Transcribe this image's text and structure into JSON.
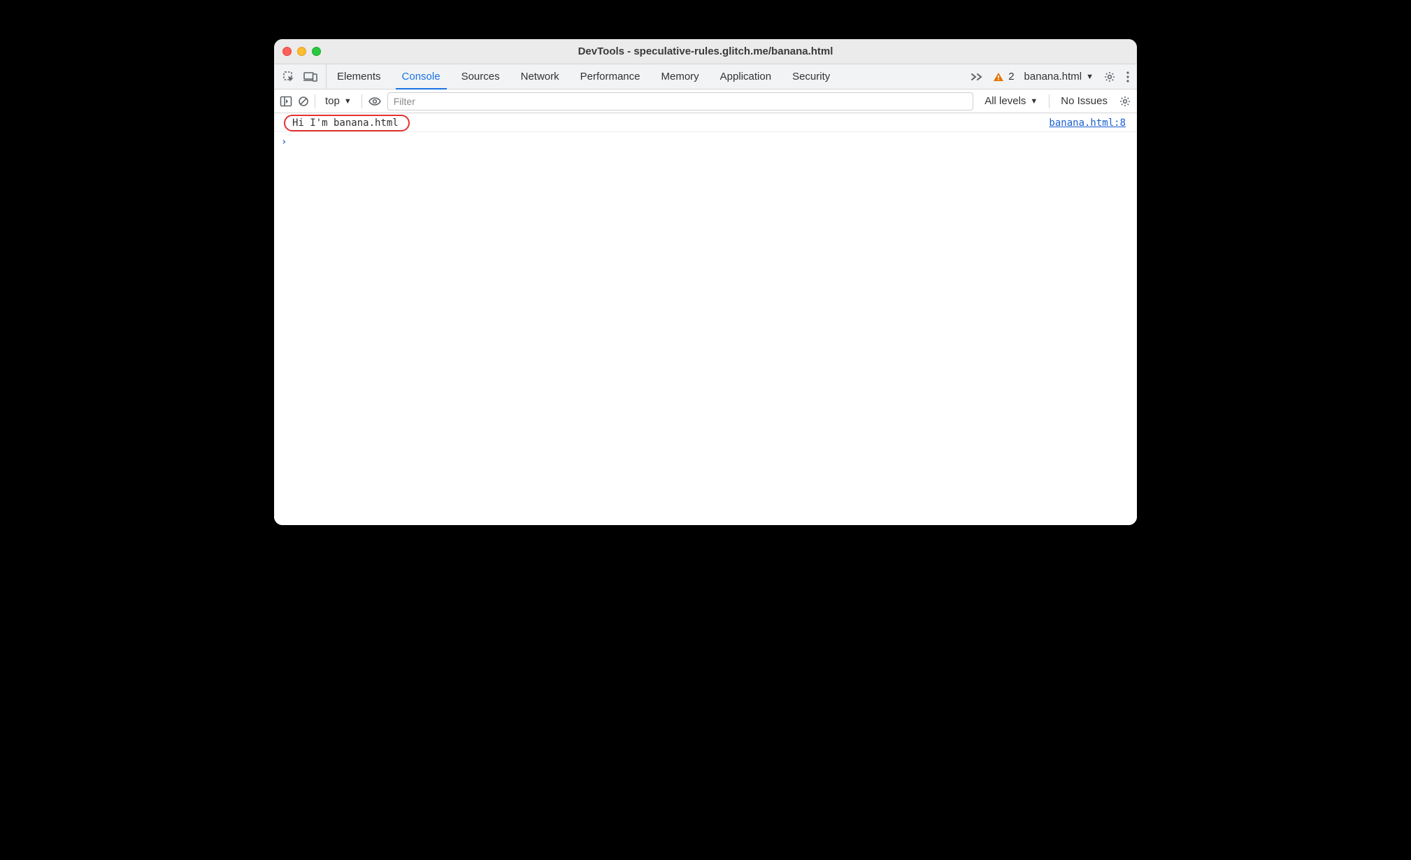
{
  "window": {
    "title": "DevTools - speculative-rules.glitch.me/banana.html"
  },
  "tabs": [
    {
      "label": "Elements",
      "active": false
    },
    {
      "label": "Console",
      "active": true
    },
    {
      "label": "Sources",
      "active": false
    },
    {
      "label": "Network",
      "active": false
    },
    {
      "label": "Performance",
      "active": false
    },
    {
      "label": "Memory",
      "active": false
    },
    {
      "label": "Application",
      "active": false
    },
    {
      "label": "Security",
      "active": false
    }
  ],
  "tabs_right": {
    "warning_count": "2",
    "target_label": "banana.html"
  },
  "console_toolbar": {
    "context_label": "top",
    "filter_placeholder": "Filter",
    "filter_value": "",
    "levels_label": "All levels",
    "issues_label": "No Issues"
  },
  "console_log": {
    "message": "Hi I'm banana.html",
    "source_link": "banana.html:8"
  }
}
